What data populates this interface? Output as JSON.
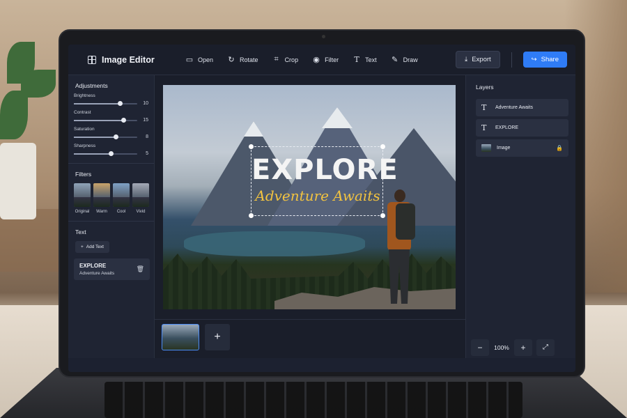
{
  "app": {
    "title": "Image Editor"
  },
  "toolbar": {
    "tools": [
      {
        "label": "Open",
        "icon": "folder-icon"
      },
      {
        "label": "Rotate",
        "icon": "rotate-icon"
      },
      {
        "label": "Crop",
        "icon": "crop-icon"
      },
      {
        "label": "Filter",
        "icon": "filter-icon"
      },
      {
        "label": "Text",
        "icon": "text-icon"
      },
      {
        "label": "Draw",
        "icon": "pen-icon"
      }
    ],
    "export_label": "Export",
    "share_label": "Share"
  },
  "adjustments": {
    "title": "Adjustments",
    "sliders": [
      {
        "label": "Brightness",
        "value": 10,
        "fill_fraction": 0.72
      },
      {
        "label": "Contrast",
        "value": 15,
        "fill_fraction": 0.78
      },
      {
        "label": "Saturation",
        "value": 8,
        "fill_fraction": 0.66
      },
      {
        "label": "Sharpness",
        "value": 5,
        "fill_fraction": 0.58
      }
    ]
  },
  "filters": {
    "title": "Filters",
    "items": [
      {
        "label": "Original",
        "color": "#8fa3b8"
      },
      {
        "label": "Warm",
        "color": "#c9a36a"
      },
      {
        "label": "Cool",
        "color": "#7fa1c6"
      },
      {
        "label": "Vivid",
        "color": "#a4a9b6"
      }
    ]
  },
  "text_panel": {
    "title": "Text",
    "add_label": "Add Text",
    "card_title": "EXPLORE",
    "card_subtitle": "Adventure Awaits"
  },
  "canvas": {
    "headline": "EXPLORE",
    "subtitle": "Adventure Awaits"
  },
  "layers": {
    "title": "Layers",
    "items": [
      {
        "label": "Adventure Awaits",
        "type": "text"
      },
      {
        "label": "EXPLORE",
        "type": "text"
      },
      {
        "label": "Image",
        "type": "image",
        "locked": true
      }
    ]
  },
  "zoom": {
    "value": "100%",
    "minus": "−",
    "plus": "+"
  },
  "colors": {
    "accent": "#2f7cf6",
    "headline": "#f4f4f4",
    "subtitle": "#f2c340"
  }
}
